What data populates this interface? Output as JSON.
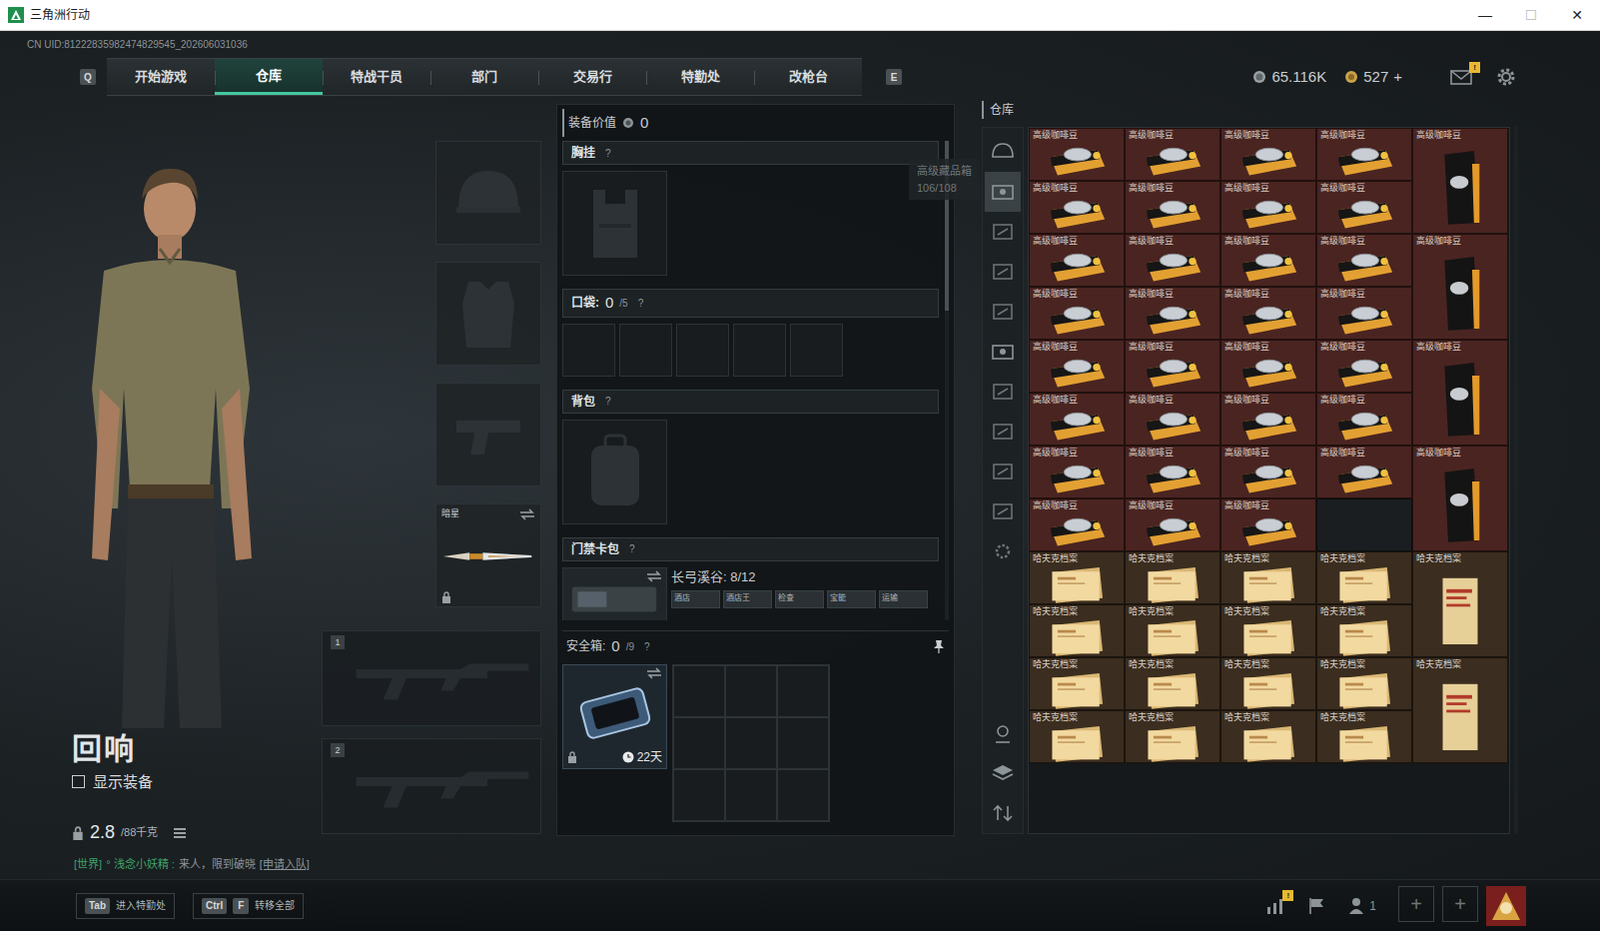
{
  "window": {
    "title": "三角洲行动",
    "controls": [
      {
        "glyph": "—",
        "disabled": false
      },
      {
        "glyph": "☐",
        "disabled": true
      },
      {
        "glyph": "✕",
        "disabled": false
      }
    ]
  },
  "uid": "CN UID:81222835982474829545_202606031036",
  "nav": {
    "prev_key": "Q",
    "next_key": "E",
    "tabs": [
      {
        "label": "开始游戏",
        "selected": false
      },
      {
        "label": "仓库",
        "selected": true
      },
      {
        "label": "特战干员",
        "selected": false
      },
      {
        "label": "部门",
        "selected": false
      },
      {
        "label": "交易行",
        "selected": false
      },
      {
        "label": "特勤处",
        "selected": false
      },
      {
        "label": "改枪台",
        "selected": false
      }
    ]
  },
  "currencies": [
    {
      "kind": "coin",
      "value": "65.116K"
    },
    {
      "kind": "coupon",
      "value": "527",
      "add": "+"
    }
  ],
  "mail": {
    "badge": "!"
  },
  "character": {
    "name": "回响",
    "show_equipment": {
      "label": "显示装备",
      "checked": false
    },
    "weight": "2.8",
    "weight_max": "/88千克"
  },
  "chat": {
    "channel": "[世界]",
    "sender": "° 浅念小妖精 :",
    "message": "来人，限到破晓",
    "action": "[申请入队]"
  },
  "hotkeys": [
    {
      "keys": [
        "Tab"
      ],
      "label": "进入特勤处"
    },
    {
      "keys": [
        "Ctrl",
        "F"
      ],
      "label": "转移全部"
    }
  ],
  "gear_slots": [
    {
      "kind": "helmet"
    },
    {
      "kind": "armor"
    },
    {
      "kind": "pistol"
    },
    {
      "kind": "melee",
      "label": "暗星",
      "locked": true
    }
  ],
  "weapon_slots": [
    {
      "number": "1"
    },
    {
      "number": "2"
    }
  ],
  "loadout": {
    "value_label": "装备价值",
    "value": "0",
    "chest_rig": {
      "label": "胸挂",
      "help": "?"
    },
    "pockets": {
      "label": "口袋:",
      "count": "0",
      "capacity": "/5",
      "help": "?",
      "slots": [
        {
          "filled": false
        },
        {
          "filled": false
        },
        {
          "filled": false
        },
        {
          "filled": false
        },
        {
          "filled": false
        }
      ]
    },
    "backpack": {
      "label": "背包",
      "help": "?"
    },
    "keycard": {
      "label": "门禁卡包",
      "help": "?",
      "map": "长弓溪谷: 8/12",
      "cards": [
        "酒店",
        "酒店王",
        "检查",
        "宝能",
        "运输"
      ]
    },
    "safe_box": {
      "label": "安全箱:",
      "count": "0",
      "capacity": "/9",
      "help": "?",
      "days": "22天",
      "locked": true,
      "slots": [
        {
          "filled": false
        },
        {
          "filled": false
        },
        {
          "filled": false
        },
        {
          "filled": false
        },
        {
          "filled": false
        },
        {
          "filled": false
        },
        {
          "filled": false
        },
        {
          "filled": false
        },
        {
          "filled": false
        }
      ]
    }
  },
  "tooltip": {
    "title": "高级藏品箱",
    "count": "106/108"
  },
  "stash": {
    "title": "仓库",
    "tabs": [
      {
        "kind": "helmet",
        "selected": false
      },
      {
        "kind": "case",
        "selected": true
      },
      {
        "kind": "tag",
        "selected": false
      },
      {
        "kind": "tag",
        "selected": false
      },
      {
        "kind": "tag",
        "selected": false
      },
      {
        "kind": "case",
        "selected": false
      },
      {
        "kind": "tag",
        "selected": false
      },
      {
        "kind": "tag",
        "selected": false
      },
      {
        "kind": "tag",
        "selected": false
      },
      {
        "kind": "tag",
        "selected": false
      },
      {
        "kind": "settings",
        "selected": false
      }
    ],
    "tools": [
      {
        "kind": "filter"
      },
      {
        "kind": "layers"
      },
      {
        "kind": "sort"
      }
    ],
    "items": [
      {
        "name": "高级咖啡豆",
        "kind": "coffee",
        "color": "#4a2421"
      },
      {
        "name": "高级咖啡豆",
        "kind": "coffee",
        "color": "#4a2421"
      },
      {
        "name": "高级咖啡豆",
        "kind": "coffee",
        "color": "#4a2421"
      },
      {
        "name": "高级咖啡豆",
        "kind": "coffee",
        "color": "#4a2421"
      },
      {
        "name": "高级咖啡豆",
        "kind": "coffeebag",
        "color": "#4a2421"
      },
      {
        "name": "高级咖啡豆",
        "kind": "coffee",
        "color": "#4a2421"
      },
      {
        "name": "高级咖啡豆",
        "kind": "coffee",
        "color": "#4a2421"
      },
      {
        "name": "高级咖啡豆",
        "kind": "coffee",
        "color": "#4a2421"
      },
      {
        "name": "高级咖啡豆",
        "kind": "coffee",
        "color": "#4a2421"
      },
      {
        "name": "高级咖啡豆",
        "kind": "coffee",
        "color": "#4a2421"
      },
      {
        "name": "高级咖啡豆",
        "kind": "coffee",
        "color": "#4a2421"
      },
      {
        "name": "高级咖啡豆",
        "kind": "coffee",
        "color": "#4a2421"
      },
      {
        "name": "高级咖啡豆",
        "kind": "coffee",
        "color": "#4a2421"
      },
      {
        "name": "高级咖啡豆",
        "kind": "coffeebag",
        "color": "#4a2421"
      },
      {
        "name": "高级咖啡豆",
        "kind": "coffee",
        "color": "#4a2421"
      },
      {
        "name": "高级咖啡豆",
        "kind": "coffee",
        "color": "#4a2421"
      },
      {
        "name": "高级咖啡豆",
        "kind": "coffee",
        "color": "#4a2421"
      },
      {
        "name": "高级咖啡豆",
        "kind": "coffee",
        "color": "#4a2421"
      },
      {
        "name": "高级咖啡豆",
        "kind": "coffee",
        "color": "#4a2421"
      },
      {
        "name": "高级咖啡豆",
        "kind": "coffee",
        "color": "#4a2421"
      },
      {
        "name": "高级咖啡豆",
        "kind": "coffee",
        "color": "#4a2421"
      },
      {
        "name": "高级咖啡豆",
        "kind": "coffee",
        "color": "#4a2421"
      },
      {
        "name": "高级咖啡豆",
        "kind": "coffeebag",
        "color": "#4a2421"
      },
      {
        "name": "高级咖啡豆",
        "kind": "coffee",
        "color": "#4a2421"
      },
      {
        "name": "高级咖啡豆",
        "kind": "coffee",
        "color": "#4a2421"
      },
      {
        "name": "高级咖啡豆",
        "kind": "coffee",
        "color": "#4a2421"
      },
      {
        "name": "高级咖啡豆",
        "kind": "coffee",
        "color": "#4a2421"
      },
      {
        "name": "高级咖啡豆",
        "kind": "coffee",
        "color": "#4a2421"
      },
      {
        "name": "高级咖啡豆",
        "kind": "coffee",
        "color": "#4a2421"
      },
      {
        "name": "高级咖啡豆",
        "kind": "coffee",
        "color": "#4a2421"
      },
      {
        "name": "高级咖啡豆",
        "kind": "coffee",
        "color": "#4a2421"
      },
      {
        "name": "高级咖啡豆",
        "kind": "coffeebag",
        "color": "#4a2421"
      },
      {
        "name": "高级咖啡豆",
        "kind": "coffee",
        "color": "#4a2421"
      },
      {
        "name": "高级咖啡豆",
        "kind": "coffee",
        "color": "#4a2421"
      },
      {
        "name": "高级咖啡豆",
        "kind": "coffee",
        "color": "#4a2421"
      },
      {
        "kind": "empty"
      },
      {
        "name": "哈夫克档案",
        "kind": "archive",
        "color": "#3b2d1f"
      },
      {
        "name": "哈夫克档案",
        "kind": "archive",
        "color": "#3b2d1f"
      },
      {
        "name": "哈夫克档案",
        "kind": "archive",
        "color": "#3b2d1f"
      },
      {
        "name": "哈夫克档案",
        "kind": "archive",
        "color": "#3b2d1f"
      },
      {
        "name": "哈夫克档案",
        "kind": "dossier",
        "color": "#3b2d1f"
      },
      {
        "name": "哈夫克档案",
        "kind": "archive",
        "color": "#3b2d1f"
      },
      {
        "name": "哈夫克档案",
        "kind": "archive",
        "color": "#3b2d1f"
      },
      {
        "name": "哈夫克档案",
        "kind": "archive",
        "color": "#3b2d1f"
      },
      {
        "name": "哈夫克档案",
        "kind": "archive",
        "color": "#3b2d1f"
      },
      {
        "name": "哈夫克档案",
        "kind": "archive",
        "color": "#3b2d1f"
      },
      {
        "name": "哈夫克档案",
        "kind": "archive",
        "color": "#3b2d1f"
      },
      {
        "name": "哈夫克档案",
        "kind": "archive",
        "color": "#3b2d1f"
      },
      {
        "name": "哈夫克档案",
        "kind": "archive",
        "color": "#3b2d1f"
      },
      {
        "name": "哈夫克档案",
        "kind": "dossier",
        "color": "#3b2d1f"
      },
      {
        "name": "哈夫克档案",
        "kind": "archive",
        "color": "#3b2d1f"
      },
      {
        "name": "哈夫克档案",
        "kind": "archive",
        "color": "#3b2d1f"
      },
      {
        "name": "哈夫克档案",
        "kind": "archive",
        "color": "#3b2d1f"
      },
      {
        "name": "哈夫克档案",
        "kind": "archive",
        "color": "#3b2d1f"
      }
    ]
  },
  "bottom_bar": {
    "stats_badge": "!",
    "friends": "1",
    "party_slots": [
      "+",
      "+"
    ]
  }
}
